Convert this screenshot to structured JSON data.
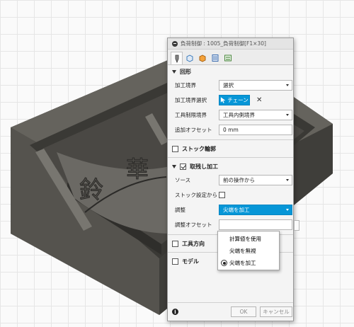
{
  "dialog": {
    "title": "負荷制御 : 1005_負荷制御[F1×30]",
    "tabs": [
      {
        "icon": "tool-icon"
      },
      {
        "icon": "stock-icon"
      },
      {
        "icon": "geometry-icon"
      },
      {
        "icon": "heights-icon"
      },
      {
        "icon": "passes-icon"
      }
    ],
    "geometry_section": "回形",
    "machining_boundary_label": "加工境界",
    "machining_boundary_value": "選択",
    "boundary_selection_label": "加工境界選択",
    "chain_button": "チェーン",
    "tool_containment_label": "工具制限境界",
    "tool_containment_value": "工具内側境界",
    "additional_offset_label": "追加オフセット",
    "additional_offset_value": "0 mm",
    "stock_contour_label": "ストック輪郭",
    "rest_machining_label": "取残し加工",
    "source_label": "ソース",
    "source_value": "前の操作から",
    "stock_setting_label": "ストック設定から",
    "adjust_label": "調整",
    "adjust_value": "尖端を加工",
    "adjust_offset_label": "調整オフセット",
    "adjust_options": [
      "計算値を使用",
      "尖端を無視",
      "尖端を加工"
    ],
    "tool_orientation_label": "工具方向",
    "model_label": "モデル",
    "ok_label": "OK",
    "cancel_label": "キャンセル"
  },
  "colors": {
    "accent": "#0696d7",
    "part": "#5b5954",
    "part_dark": "#3c3b38"
  }
}
